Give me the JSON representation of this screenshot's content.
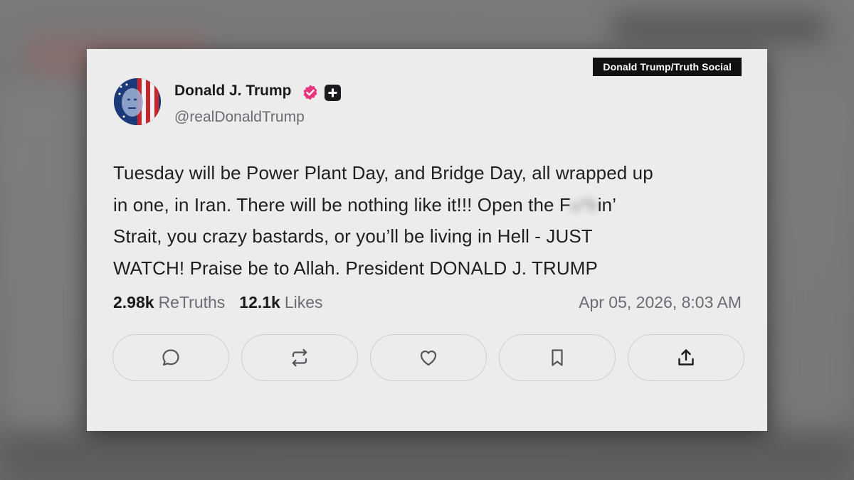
{
  "source_tag": "Donald Trump/Truth Social",
  "post": {
    "author": {
      "name": "Donald J. Trump",
      "handle": "@realDonaldTrump",
      "avatar": "flag-portrait-avatar",
      "verified_icon": "verified-badge-icon",
      "verified_color": "#e8357f",
      "plus_icon": "plus-badge-icon"
    },
    "body_lines": [
      "Tuesday will be Power Plant Day, and Bridge Day, all wrapped up",
      "in one, in Iran. There will be nothing like it!!! Open the F",
      "Strait, you crazy bastards, or you’ll be living in Hell - JUST",
      "WATCH! Praise be to Allah. President DONALD J. TRUMP"
    ],
    "censored_fragment": "u*k",
    "line2_tail": "in’",
    "retruths_count": "2.98k",
    "retruths_label": "ReTruths",
    "likes_count": "12.1k",
    "likes_label": "Likes",
    "timestamp": "Apr 05, 2026, 8:03 AM"
  },
  "actions": [
    {
      "name": "reply",
      "icon": "comment-icon"
    },
    {
      "name": "retruth",
      "icon": "repost-icon"
    },
    {
      "name": "like",
      "icon": "heart-icon"
    },
    {
      "name": "bookmark",
      "icon": "bookmark-icon"
    },
    {
      "name": "share",
      "icon": "share-icon"
    }
  ],
  "colors": {
    "card_bg": "#ececed",
    "text": "#1f1f23",
    "muted": "#6b6b74",
    "tag_bg": "#111111"
  }
}
